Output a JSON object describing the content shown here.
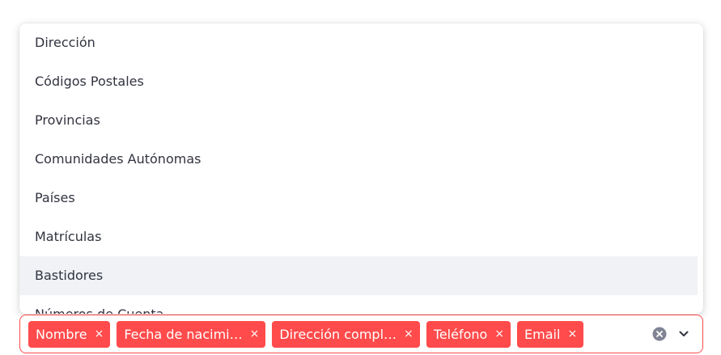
{
  "dropdown": {
    "options": [
      {
        "label": "Dirección"
      },
      {
        "label": "Códigos Postales"
      },
      {
        "label": "Provincias"
      },
      {
        "label": "Comunidades Autónomas"
      },
      {
        "label": "Países"
      },
      {
        "label": "Matrículas"
      },
      {
        "label": "Bastidores"
      },
      {
        "label": "Números de Cuenta"
      }
    ],
    "highlighted_option": "Bastidores"
  },
  "multiselect": {
    "selected": [
      {
        "label": "Nombre"
      },
      {
        "label": "Fecha de nacimi…"
      },
      {
        "label": "Dirección compl…"
      },
      {
        "label": "Teléfono"
      },
      {
        "label": "Email"
      }
    ],
    "remove_symbol": "×"
  },
  "colors": {
    "accent": "#ff4b4b",
    "hover_background": "#f0f2f6",
    "text": "#31333f",
    "icon": "#808495"
  },
  "icons": {
    "tag_remove": "close-icon",
    "clear_all": "clear-circle-icon",
    "expand": "chevron-down-icon"
  }
}
